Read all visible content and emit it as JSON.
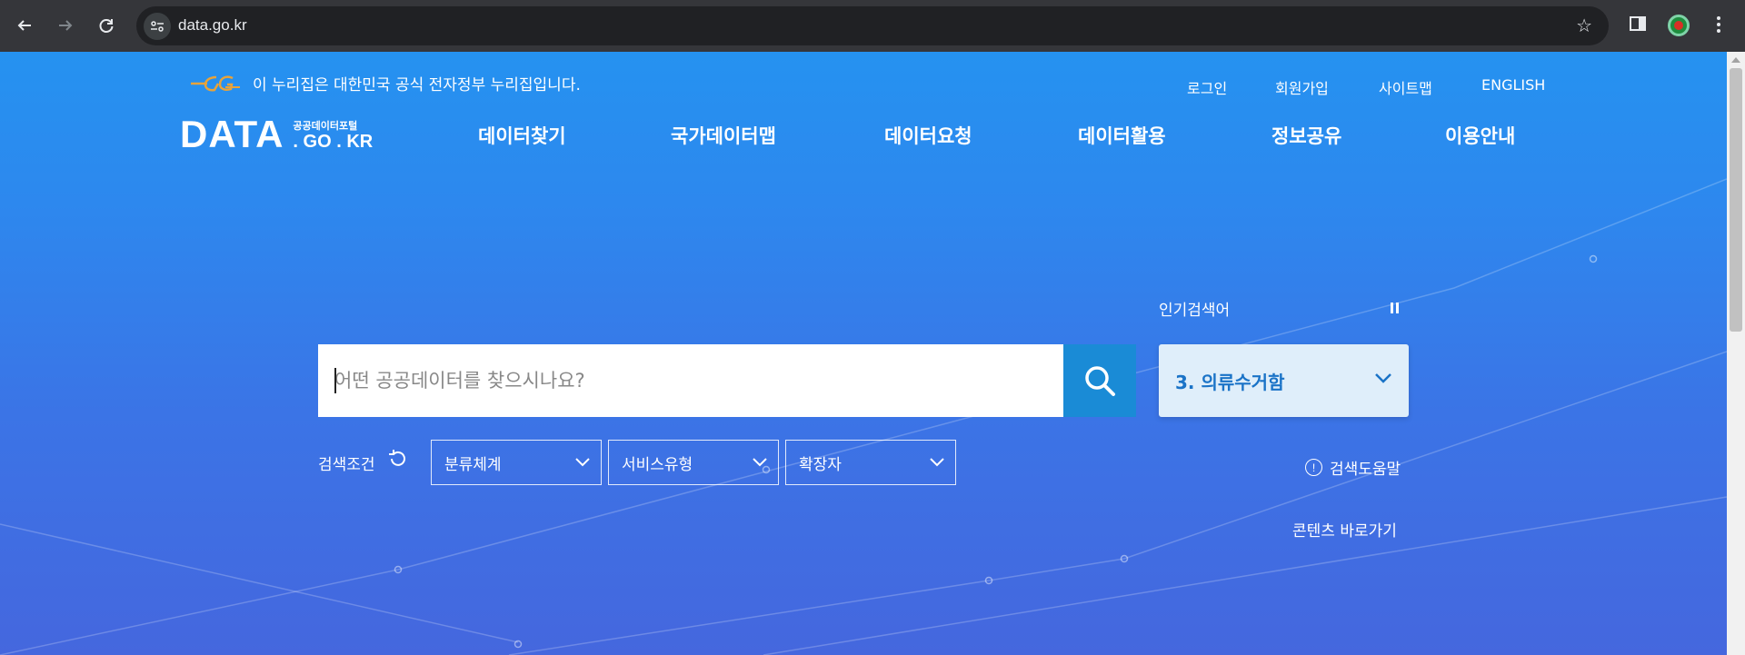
{
  "browser": {
    "url": "data.go.kr"
  },
  "page": {
    "gov_notice": "이 누리집은 대한민국 공식 전자정부 누리집입니다.",
    "utility_links": [
      "로그인",
      "회원가입",
      "사이트맵",
      "ENGLISH"
    ],
    "logo": {
      "main": "DATA",
      "sub": "공공데이터포털",
      "domain": ". GO . KR"
    },
    "nav": [
      "데이터찾기",
      "국가데이터맵",
      "데이터요청",
      "데이터활용",
      "정보공유",
      "이용안내"
    ],
    "search": {
      "placeholder": "어떤 공공데이터를 찾으시나요?",
      "value": ""
    },
    "popular": {
      "label": "인기검색어",
      "current": "3. 의류수거함"
    },
    "conditions": {
      "label": "검색조건",
      "selects": [
        "분류체계",
        "서비스유형",
        "확장자"
      ]
    },
    "help_label": "검색도움말",
    "skip_label": "콘텐츠 바로가기"
  },
  "colors": {
    "bg_top": "#2592f0",
    "bg_bottom": "#4567de",
    "search_button": "#1a8bd6",
    "popular_text": "#1a73c7",
    "popular_bg": "#dfeefa"
  }
}
